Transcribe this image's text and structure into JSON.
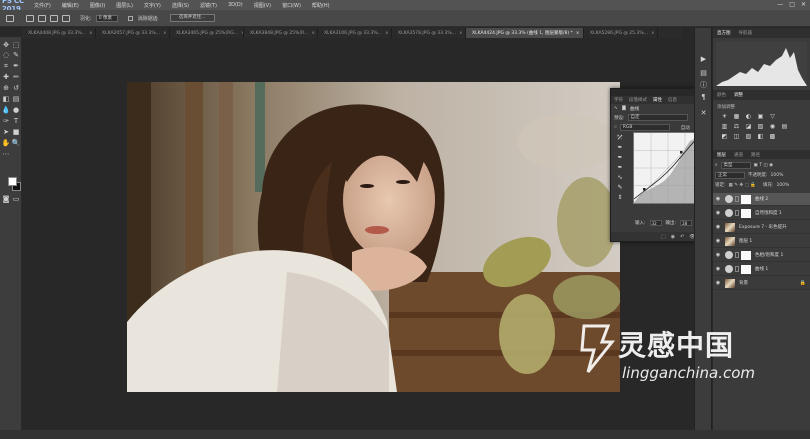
{
  "app": {
    "logo": "PS CC 2019",
    "accent": "#9ec9ff"
  },
  "menubar": {
    "items": [
      "文件(F)",
      "编辑(E)",
      "图像(I)",
      "图层(L)",
      "文字(Y)",
      "选择(S)",
      "滤镜(T)",
      "3D(D)",
      "视图(V)",
      "窗口(W)",
      "帮助(H)"
    ],
    "controls": [
      "—",
      "□",
      "✕"
    ]
  },
  "options": {
    "feather_label": "羽化:",
    "feather_value": "0 像素",
    "antialias_label": "消除锯齿",
    "select_mask_button": "选择并遮住..."
  },
  "tabs": [
    {
      "label": "XLKA4408.JPG @ 33.3%...",
      "close": "×"
    },
    {
      "label": "XLKA2057.JPG @ 33.3%...",
      "close": "×"
    },
    {
      "label": "XLKA3465.JPG @ 25%(RG...",
      "close": "×"
    },
    {
      "label": "XLKA3848.JPG @ 25%(R...",
      "close": "×"
    },
    {
      "label": "XLKA3106.JPG @ 33.3%...",
      "close": "×"
    },
    {
      "label": "XLKA3578.JPG @ 33.3%...",
      "close": "×"
    },
    {
      "label": "XLKA4424.JPG @ 33.3% (曲线 1, 图层蒙版/8) *",
      "close": "×"
    },
    {
      "label": "XLKA5286.JPG @ 25.3%...",
      "close": "×"
    }
  ],
  "histogram_panel": {
    "tabs": [
      "直方图",
      "导航器"
    ]
  },
  "adjustments_panel": {
    "tabs": [
      "颜色",
      "调整"
    ],
    "title": "添加调整",
    "row1": [
      "☀",
      "▦",
      "◐",
      "▣",
      "▽"
    ],
    "row2": [
      "▥",
      "⚖",
      "◪",
      "▧",
      "◉",
      "▤"
    ],
    "row3": [
      "◩",
      "◫",
      "▨",
      "◧",
      "▩"
    ]
  },
  "properties_panel": {
    "top_icons": [
      "«",
      "✕"
    ],
    "tabs": [
      "字符",
      "段落样式",
      "属性",
      "信息"
    ],
    "head_label": "曲线",
    "preset_label": "预设:",
    "preset_value": "自定",
    "channel_value": "RGB",
    "auto_button": "自动",
    "input_label": "输入:",
    "input_value": "32",
    "output_label": "输出:",
    "output_value": "28",
    "tools": [
      "⤱",
      "✒",
      "✒",
      "✒",
      "∿",
      "✎",
      "⇕"
    ],
    "footer_icons": [
      "⬚",
      "◉",
      "↶",
      "👁",
      "🗑"
    ]
  },
  "layers_panel": {
    "tabs": [
      "图层",
      "通道",
      "路径"
    ],
    "filter_label": "类型",
    "blend_mode": "正常",
    "opacity_label": "不透明度:",
    "opacity_value": "100%",
    "lock_label": "锁定:",
    "fill_label": "填充:",
    "fill_value": "100%",
    "layers": [
      {
        "name": "曲线 2",
        "kind": "adjustment",
        "selected": true
      },
      {
        "name": "自然饱和度 1",
        "kind": "adjustment",
        "selected": false
      },
      {
        "name": "Exposure 7 - 彩色提升",
        "kind": "image",
        "selected": false
      },
      {
        "name": "图层 1",
        "kind": "image",
        "selected": false
      },
      {
        "name": "色相/饱和度 1",
        "kind": "adjustment",
        "selected": false
      },
      {
        "name": "曲线 1",
        "kind": "adjustment",
        "selected": false
      },
      {
        "name": "背景",
        "kind": "image",
        "selected": false
      }
    ]
  },
  "watermark": {
    "text": "灵感中国",
    "url": "lingganchina.com"
  }
}
